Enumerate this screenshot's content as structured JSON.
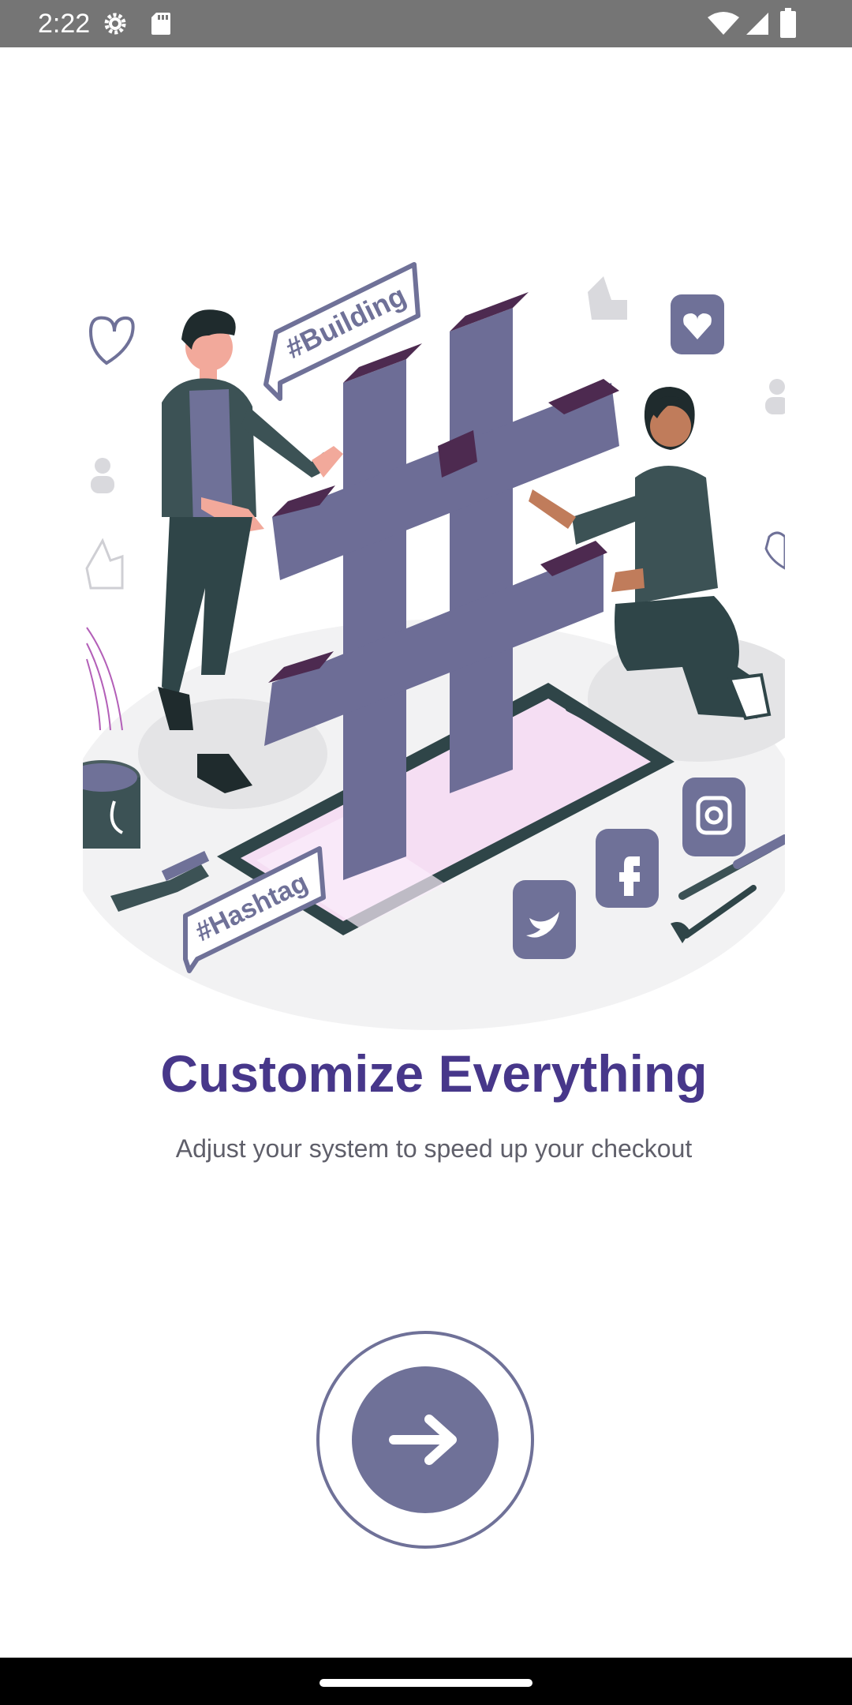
{
  "status_bar": {
    "time": "2:22",
    "icons": [
      "settings-icon",
      "sd-card-icon",
      "wifi-icon",
      "signal-icon",
      "battery-icon"
    ]
  },
  "illustration": {
    "building_tag": "#Building",
    "hashtag_tag": "#Hashtag",
    "social_icons": [
      "twitter-icon",
      "facebook-icon",
      "instagram-icon"
    ]
  },
  "onboarding": {
    "title": "Customize Everything",
    "subtitle": "Adjust your system to speed up your checkout",
    "next_icon": "arrow-right-icon"
  },
  "colors": {
    "accent": "#6f7198",
    "title": "#47378a",
    "hashtag_top": "#4d2a50",
    "status_bar": "#757575"
  }
}
